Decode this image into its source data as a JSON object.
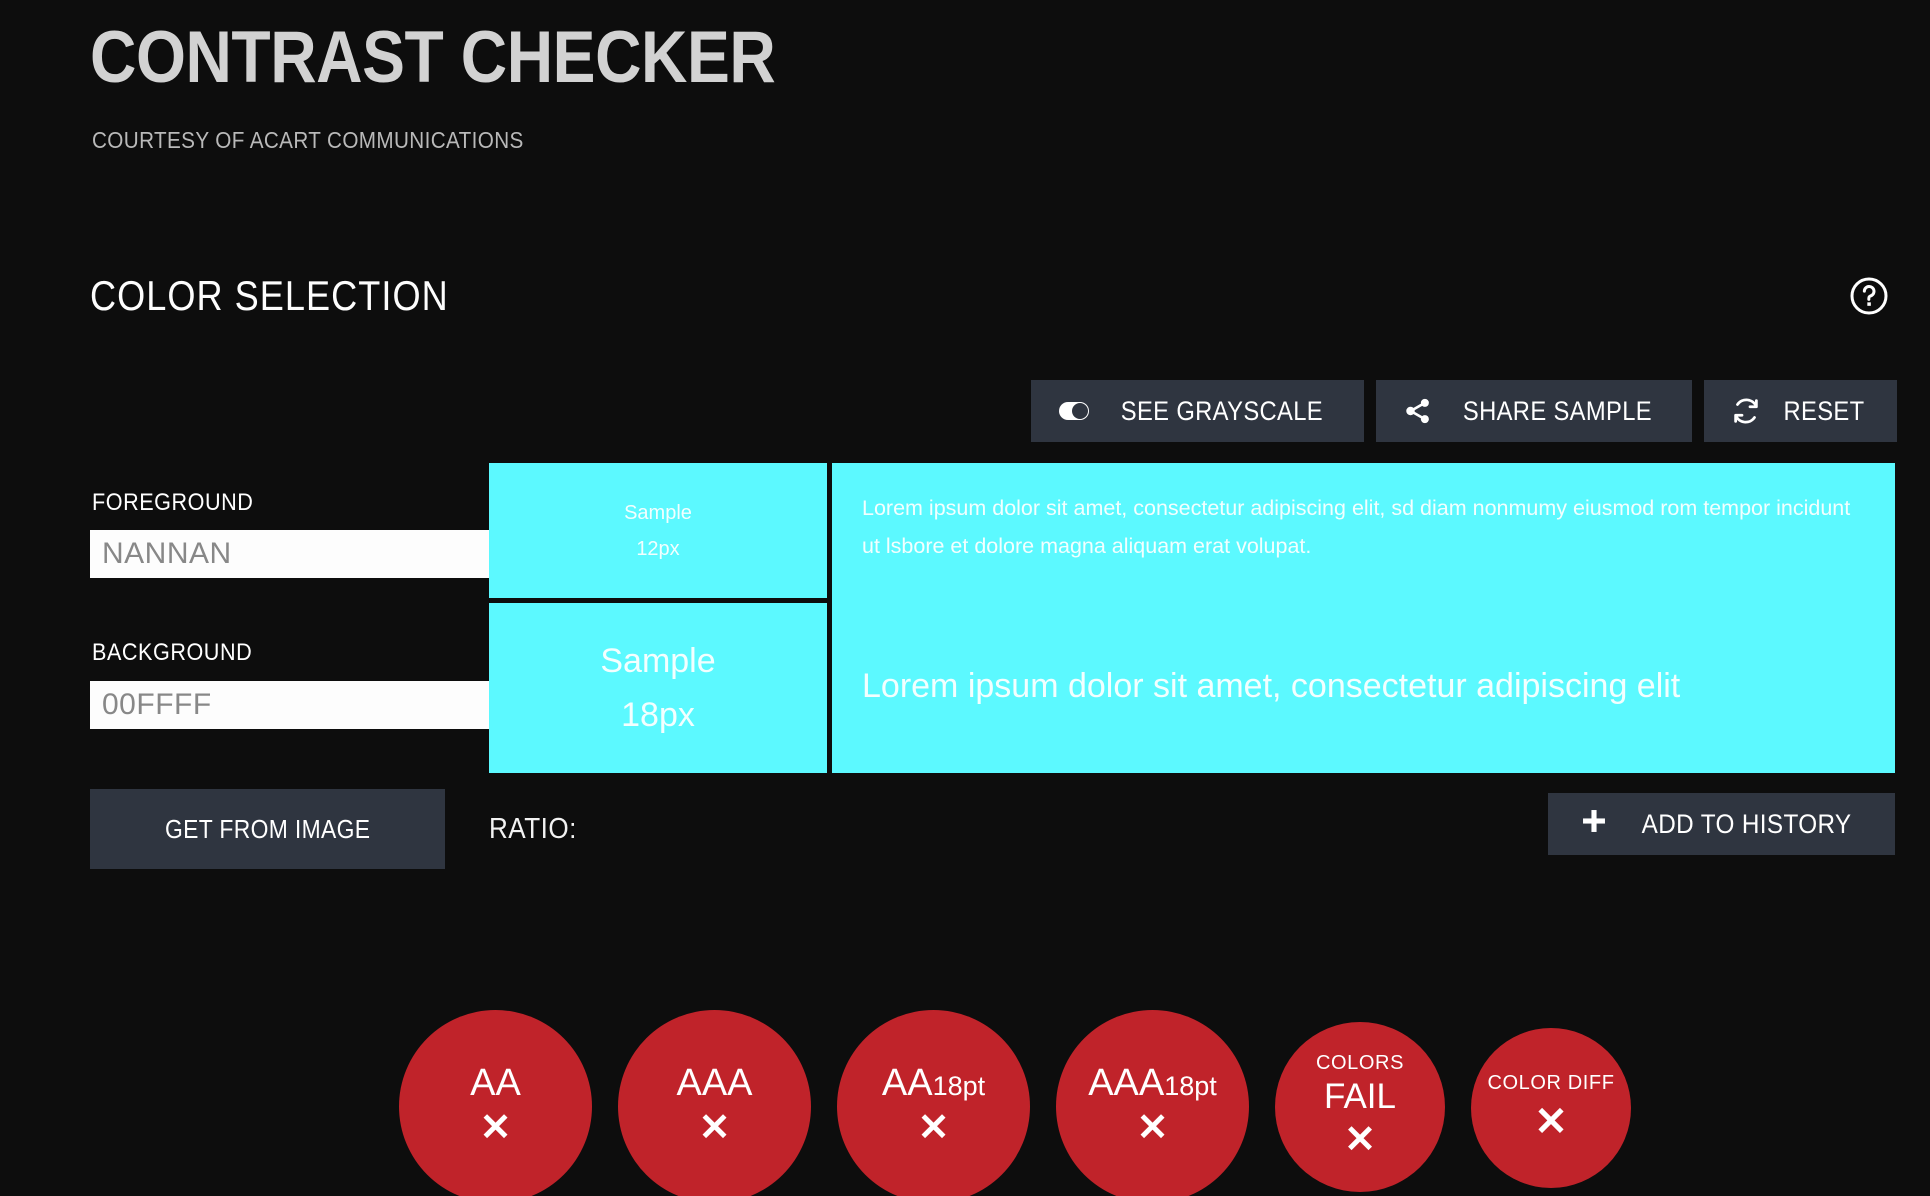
{
  "header": {
    "title": "CONTRAST CHECKER",
    "subtitle": "COURTESY OF ACART COMMUNICATIONS"
  },
  "section": {
    "title": "COLOR SELECTION",
    "help_icon": "help-circle-icon"
  },
  "toolbar": {
    "grayscale_label": "SEE GRAYSCALE",
    "grayscale_icon": "toggle-switch-icon",
    "share_label": "SHARE SAMPLE",
    "share_icon": "share-nodes-icon",
    "reset_label": "RESET",
    "reset_icon": "refresh-icon"
  },
  "controls": {
    "foreground_label": "FOREGROUND",
    "foreground_value": "NANNAN",
    "foreground_placeholder": "NANNAN",
    "background_label": "BACKGROUND",
    "background_value": "00FFFF",
    "background_placeholder": "00FFFF",
    "get_from_image_label": "GET FROM IMAGE",
    "swatch_icon": "color-palette-icon"
  },
  "sample": {
    "background_color": "#5CF9FF",
    "foreground_color": "#FFFFFF",
    "small_sample_line1": "Sample",
    "small_sample_line2": "12px",
    "large_sample_line1": "Sample",
    "large_sample_line2": "18px",
    "lorem_small": "Lorem ipsum dolor sit amet, consectetur adipiscing elit, sd diam nonmumy eiusmod rom tempor incidunt ut lsbore et dolore magna aliquam erat volupat.",
    "lorem_large": "Lorem ipsum dolor sit amet, consectetur adipiscing elit"
  },
  "ratio": {
    "label": "RATIO:",
    "value": ""
  },
  "history": {
    "add_label": "ADD TO HISTORY",
    "add_icon": "plus-icon"
  },
  "results": {
    "fail_color": "#C0232A",
    "badges": [
      {
        "name": "aa",
        "main": "AA",
        "sub": "",
        "caption": "",
        "status": "",
        "mark": "✕"
      },
      {
        "name": "aaa",
        "main": "AAA",
        "sub": "",
        "caption": "",
        "status": "",
        "mark": "✕"
      },
      {
        "name": "aa-18pt",
        "main": "AA",
        "sub": "18pt",
        "caption": "",
        "status": "",
        "mark": "✕"
      },
      {
        "name": "aaa-18pt",
        "main": "AAA",
        "sub": "18pt",
        "caption": "",
        "status": "",
        "mark": "✕"
      },
      {
        "name": "colors",
        "main": "",
        "sub": "",
        "caption": "COLORS",
        "status": "FAIL",
        "mark": "✕"
      },
      {
        "name": "color-diff",
        "main": "",
        "sub": "",
        "caption": "COLOR DIFF",
        "status": "",
        "mark": "✕"
      }
    ]
  },
  "palette": {
    "colors": [
      "#f2c9c9",
      "#e09d9d",
      "#c76a6a",
      "#d7efc0",
      "#aadd88",
      "#8fc96b",
      "#e8504a",
      "#e01e1e",
      "#d41212",
      "#f0a03c",
      "#ef7b22",
      "#e85a1b",
      "#bfe8a8",
      "#7fd46b",
      "#2fb83a",
      "#9de8ef",
      "#4fd8e8",
      "#22c3d6",
      "#f6f09a",
      "#f3e45c",
      "#efd41f",
      "#ef7fe0",
      "#e24fd4",
      "#d62bc8",
      "#9aa8e8",
      "#6a5fd4",
      "#4b3fc0",
      "#f0b7d4",
      "#e86fb0",
      "#d6338f",
      "#cfcfcf",
      "#8a8a8a",
      "#111111",
      "#6b3a2a",
      "#4a2519",
      "#2d1a12"
    ]
  }
}
